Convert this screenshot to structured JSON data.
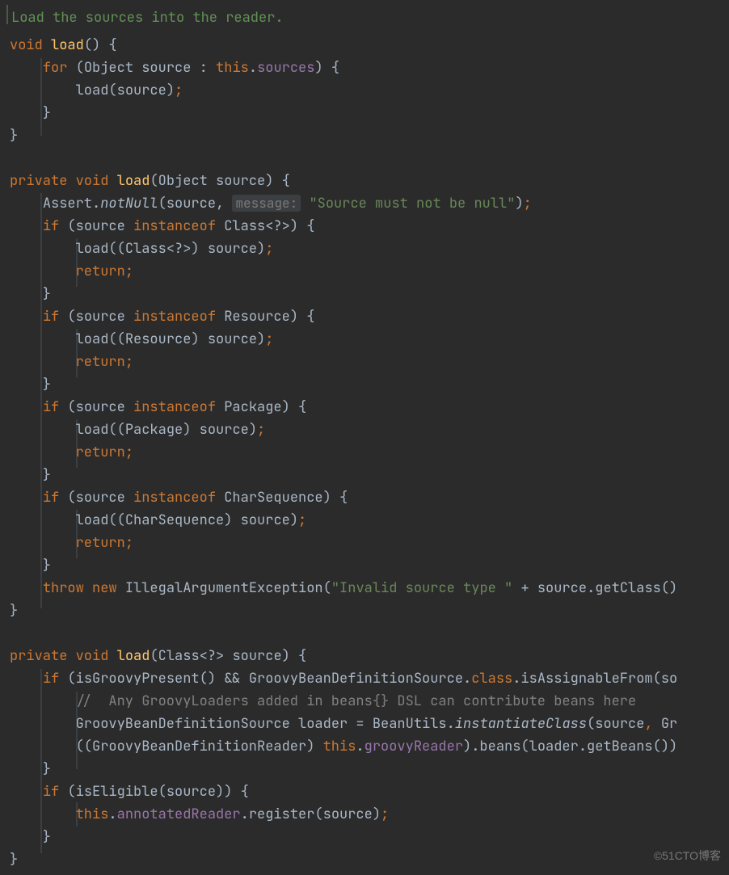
{
  "doc": "Load the sources into the reader.",
  "code": {
    "void": "void",
    "load": "load",
    "for": "for",
    "Object": "Object",
    "source": "source",
    "this": "this",
    "sources": "sources",
    "private": "private",
    "Assert": "Assert",
    "notNull": "notNull",
    "msgHint": "message:",
    "nullMsg": "\"Source must not be null\"",
    "if": "if",
    "instanceof": "instanceof",
    "Class": "Class<?>",
    "klassCast": "(Class<?>)",
    "return": "return",
    "Resource": "Resource",
    "Package": "Package",
    "CharSequence": "CharSequence",
    "throw": "throw",
    "new": "new",
    "IllegalArgumentException": "IllegalArgumentException",
    "invalid": "\"Invalid source type \"",
    "getClass": ".getClass()",
    "isGroovyPresent": "isGroovyPresent",
    "GroovyBeanDefinitionSource": "GroovyBeanDefinitionSource",
    "class": "class",
    "isAssignableFrom": ".isAssignableFrom(so",
    "groovyCmt": "//  Any GroovyLoaders added in beans{} DSL can contribute beans here",
    "loader": "loader",
    "BeanUtils": "BeanUtils",
    "instantiateClass": "instantiateClass",
    "comma": ", ",
    "Gr": "Gr",
    "GroovyBeanDefinitionReader": "GroovyBeanDefinitionReader",
    "groovyReader": "groovyReader",
    "beans": ".beans(loader.getBeans())",
    "isEligible": "isEligible",
    "annotatedReader": "annotatedReader",
    "register": ".register(source)"
  },
  "watermark": "©51CTO博客"
}
